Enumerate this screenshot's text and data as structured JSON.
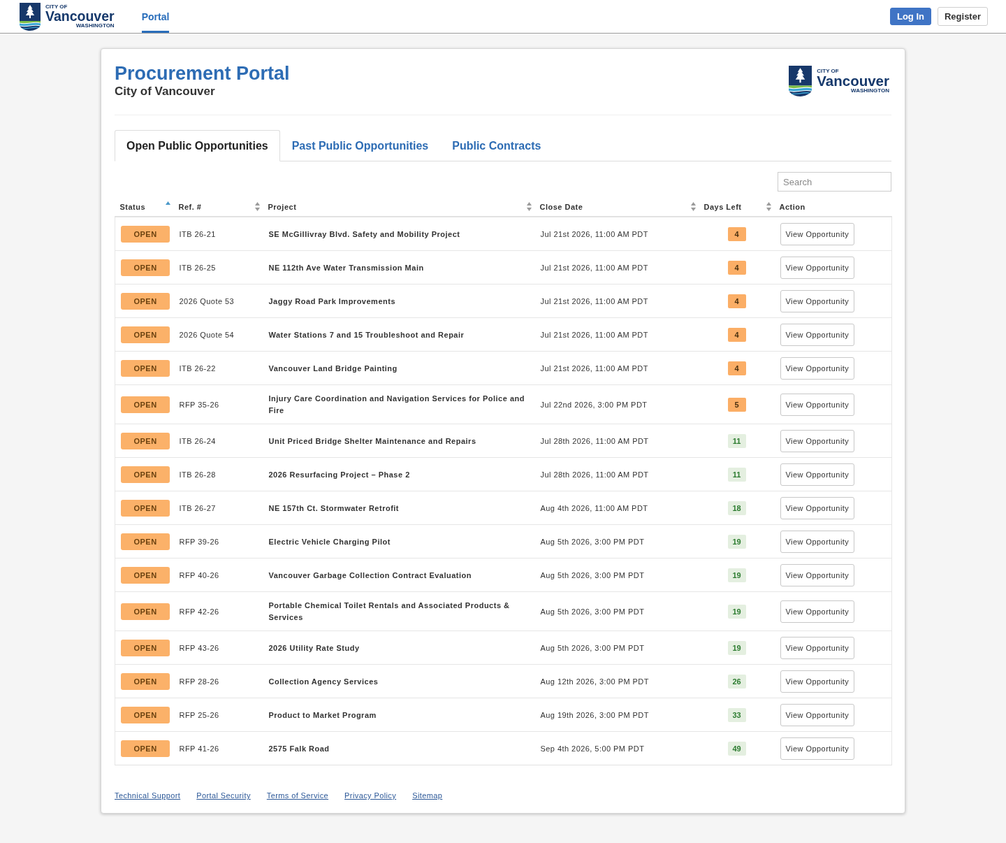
{
  "nav": {
    "logo": {
      "top": "CITY OF",
      "name": "Vancouver",
      "bottom": "WASHINGTON"
    },
    "tabs": [
      {
        "label": "Portal",
        "selected": true
      }
    ],
    "buttons": [
      {
        "label": "Log In",
        "kind": "primary"
      },
      {
        "label": "Register",
        "kind": "secondary"
      }
    ]
  },
  "header": {
    "title": "Procurement Portal",
    "subtitle": "City of Vancouver",
    "logo": {
      "top": "CITY OF",
      "name": "Vancouver",
      "bottom": "WASHINGTON"
    }
  },
  "tabs": [
    {
      "label": "Open Public Opportunities",
      "selected": true
    },
    {
      "label": "Past Public Opportunities",
      "selected": false
    },
    {
      "label": "Public Contracts",
      "selected": false
    }
  ],
  "search": {
    "placeholder": "Search"
  },
  "table": {
    "columns": [
      {
        "label": "Status",
        "kind": "sorted"
      },
      {
        "label": "Ref. #",
        "kind": "sortable"
      },
      {
        "label": "Project",
        "kind": "sortable"
      },
      {
        "label": "Close Date",
        "kind": "sortable"
      },
      {
        "label": "Days Left",
        "kind": "sortable"
      },
      {
        "label": "Action",
        "kind": "plain"
      }
    ],
    "rows": [
      {
        "status": "OPEN",
        "ref": "ITB 26-21",
        "project": "SE McGillivray Blvd. Safety and Mobility Project",
        "close_date": "Jul 21st 2026, 11:00 AM PDT",
        "days_left": "4",
        "urgent": true,
        "action": "View Opportunity"
      },
      {
        "status": "OPEN",
        "ref": "ITB 26-25",
        "project": "NE 112th Ave Water Transmission Main",
        "close_date": "Jul 21st 2026, 11:00 AM PDT",
        "days_left": "4",
        "urgent": true,
        "action": "View Opportunity"
      },
      {
        "status": "OPEN",
        "ref": "2026 Quote 53",
        "project": "Jaggy Road Park Improvements",
        "close_date": "Jul 21st 2026, 11:00 AM PDT",
        "days_left": "4",
        "urgent": true,
        "action": "View Opportunity"
      },
      {
        "status": "OPEN",
        "ref": "2026 Quote 54",
        "project": "Water Stations 7 and 15 Troubleshoot and Repair",
        "close_date": "Jul 21st 2026, 11:00 AM PDT",
        "days_left": "4",
        "urgent": true,
        "action": "View Opportunity"
      },
      {
        "status": "OPEN",
        "ref": "ITB 26-22",
        "project": "Vancouver Land Bridge Painting",
        "close_date": "Jul 21st 2026, 11:00 AM PDT",
        "days_left": "4",
        "urgent": true,
        "action": "View Opportunity"
      },
      {
        "status": "OPEN",
        "ref": "RFP 35-26",
        "project": "Injury Care Coordination and Navigation Services for Police and Fire",
        "close_date": "Jul 22nd 2026, 3:00 PM PDT",
        "days_left": "5",
        "urgent": true,
        "action": "View Opportunity"
      },
      {
        "status": "OPEN",
        "ref": "ITB 26-24",
        "project": "Unit Priced Bridge Shelter Maintenance and Repairs",
        "close_date": "Jul 28th 2026, 11:00 AM PDT",
        "days_left": "11",
        "urgent": false,
        "action": "View Opportunity"
      },
      {
        "status": "OPEN",
        "ref": "ITB 26-28",
        "project": "2026 Resurfacing Project – Phase 2",
        "close_date": "Jul 28th 2026, 11:00 AM PDT",
        "days_left": "11",
        "urgent": false,
        "action": "View Opportunity"
      },
      {
        "status": "OPEN",
        "ref": "ITB 26-27",
        "project": "NE 157th Ct. Stormwater Retrofit",
        "close_date": "Aug 4th 2026, 11:00 AM PDT",
        "days_left": "18",
        "urgent": false,
        "action": "View Opportunity"
      },
      {
        "status": "OPEN",
        "ref": "RFP 39-26",
        "project": "Electric Vehicle Charging Pilot",
        "close_date": "Aug 5th 2026, 3:00 PM PDT",
        "days_left": "19",
        "urgent": false,
        "action": "View Opportunity"
      },
      {
        "status": "OPEN",
        "ref": "RFP 40-26",
        "project": "Vancouver Garbage Collection Contract Evaluation",
        "close_date": "Aug 5th 2026, 3:00 PM PDT",
        "days_left": "19",
        "urgent": false,
        "action": "View Opportunity"
      },
      {
        "status": "OPEN",
        "ref": "RFP 42-26",
        "project": "Portable Chemical Toilet Rentals and Associated Products & Services",
        "close_date": "Aug 5th 2026, 3:00 PM PDT",
        "days_left": "19",
        "urgent": false,
        "action": "View Opportunity"
      },
      {
        "status": "OPEN",
        "ref": "RFP 43-26",
        "project": "2026 Utility Rate Study",
        "close_date": "Aug 5th 2026, 3:00 PM PDT",
        "days_left": "19",
        "urgent": false,
        "action": "View Opportunity"
      },
      {
        "status": "OPEN",
        "ref": "RFP 28-26",
        "project": "Collection Agency Services",
        "close_date": "Aug 12th 2026, 3:00 PM PDT",
        "days_left": "26",
        "urgent": false,
        "action": "View Opportunity"
      },
      {
        "status": "OPEN",
        "ref": "RFP 25-26",
        "project": "Product to Market Program",
        "close_date": "Aug 19th 2026, 3:00 PM PDT",
        "days_left": "33",
        "urgent": false,
        "action": "View Opportunity"
      },
      {
        "status": "OPEN",
        "ref": "RFP 41-26",
        "project": "2575 Falk Road",
        "close_date": "Sep 4th 2026, 5:00 PM PDT",
        "days_left": "49",
        "urgent": false,
        "action": "View Opportunity"
      }
    ]
  },
  "footer_links": [
    "Technical Support",
    "Portal Security",
    "Terms of Service",
    "Privacy Policy",
    "Sitemap"
  ]
}
